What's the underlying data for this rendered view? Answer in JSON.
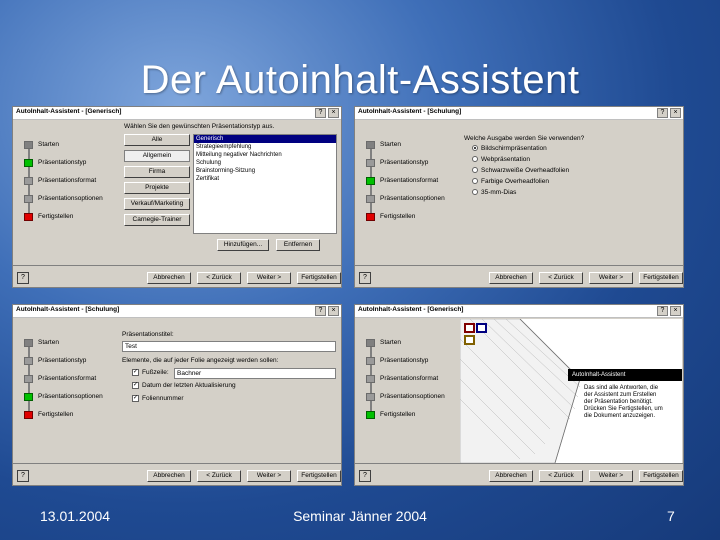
{
  "slide": {
    "title": "Der Autoinhalt-Assistent",
    "footer_date": "13.01.2004",
    "footer_center": "Seminar Jänner 2004",
    "footer_page": "7"
  },
  "common": {
    "help_button": "?",
    "close_button": "×",
    "help_icon": "?",
    "nav_back": "Abbrechen",
    "nav_prev": "< Zurück",
    "nav_next": "Weiter >",
    "nav_finish": "Fertigstellen"
  },
  "dialog1": {
    "title": "AutoInhalt-Assistent - [Generisch]",
    "steps": [
      "Starten",
      "Präsentationstyp",
      "Präsentationsformat",
      "Präsentationsoptionen",
      "Fertigstellen"
    ],
    "prompt": "Wählen Sie den gewünschten Präsentationstyp aus.",
    "category_buttons": [
      "Alle",
      "Allgemein",
      "Firma",
      "Projekte",
      "Verkauf/Marketing",
      "Carnegie-Trainer"
    ],
    "list_items": [
      "Generisch",
      "Strategieempfehlung",
      "Mitteilung negativer Nachrichten",
      "Schulung",
      "Brainstorming-Sitzung",
      "Zertifikat"
    ],
    "add_button": "Hinzufügen...",
    "remove_button": "Entfernen"
  },
  "dialog2": {
    "title": "AutoInhalt-Assistent - [Schulung]",
    "steps": [
      "Starten",
      "Präsentationstyp",
      "Präsentationsformat",
      "Präsentationsoptionen",
      "Fertigstellen"
    ],
    "prompt": "Welche Ausgabe werden Sie verwenden?",
    "radio_options": [
      "Bildschirmpräsentation",
      "Webpräsentation",
      "Schwarzweiße Overheadfolien",
      "Farbige Overheadfolien",
      "35-mm-Dias"
    ]
  },
  "dialog3": {
    "title": "AutoInhalt-Assistent - [Schulung]",
    "steps": [
      "Starten",
      "Präsentationstyp",
      "Präsentationsformat",
      "Präsentationsoptionen",
      "Fertigstellen"
    ],
    "title_label": "Präsentationstitel:",
    "title_value": "Test",
    "footer_label": "Elemente, die auf jeder Folie angezeigt werden sollen:",
    "footer_check_label": "Fußzeile:",
    "footer_value": "Bachner",
    "date_check_label": "Datum der letzten Aktualisierung",
    "slide_number_label": "Foliennummer",
    "check_mark": "✓"
  },
  "dialog4": {
    "title": "AutoInhalt-Assistent - [Generisch]",
    "steps": [
      "Starten",
      "Präsentationstyp",
      "Präsentationsformat",
      "Präsentationsoptionen",
      "Fertigstellen"
    ],
    "dark_bar_text": "AutoInhalt-Assistent",
    "balloon_text": "Das sind alle Antworten, die der Assistent zum Erstellen der Präsentation benötigt. Drücken Sie Fertigstellen, um die Dokument anzuzeigen."
  },
  "colors": {
    "active_step": "#000080",
    "step_done": "#00c000",
    "step_finish": "#e00000"
  }
}
